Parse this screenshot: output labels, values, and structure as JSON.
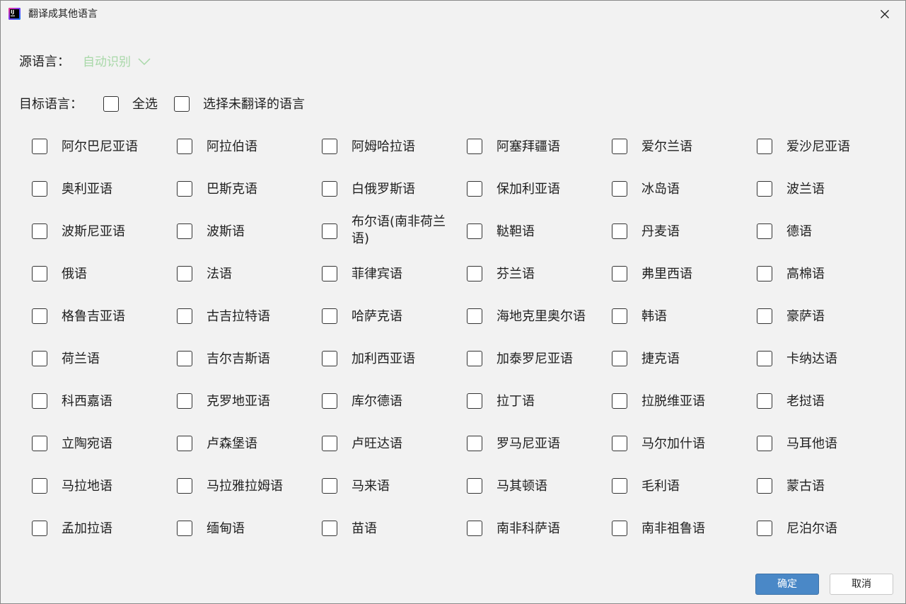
{
  "window": {
    "title": "翻译成其他语言"
  },
  "source": {
    "label": "源语言：",
    "value": "自动识别"
  },
  "target": {
    "label": "目标语言：",
    "select_all": "全选",
    "select_untranslated": "选择未翻译的语言"
  },
  "languages": [
    [
      "阿尔巴尼亚语",
      "阿拉伯语",
      "阿姆哈拉语",
      "阿塞拜疆语",
      "爱尔兰语",
      "爱沙尼亚语"
    ],
    [
      "奥利亚语",
      "巴斯克语",
      "白俄罗斯语",
      "保加利亚语",
      "冰岛语",
      "波兰语"
    ],
    [
      "波斯尼亚语",
      "波斯语",
      "布尔语(南非荷兰语)",
      "鞑靼语",
      "丹麦语",
      "德语"
    ],
    [
      "俄语",
      "法语",
      "菲律宾语",
      "芬兰语",
      "弗里西语",
      "高棉语"
    ],
    [
      "格鲁吉亚语",
      "古吉拉特语",
      "哈萨克语",
      "海地克里奥尔语",
      "韩语",
      "豪萨语"
    ],
    [
      "荷兰语",
      "吉尔吉斯语",
      "加利西亚语",
      "加泰罗尼亚语",
      "捷克语",
      "卡纳达语"
    ],
    [
      "科西嘉语",
      "克罗地亚语",
      "库尔德语",
      "拉丁语",
      "拉脱维亚语",
      "老挝语"
    ],
    [
      "立陶宛语",
      "卢森堡语",
      "卢旺达语",
      "罗马尼亚语",
      "马尔加什语",
      "马耳他语"
    ],
    [
      "马拉地语",
      "马拉雅拉姆语",
      "马来语",
      "马其顿语",
      "毛利语",
      "蒙古语"
    ],
    [
      "孟加拉语",
      "缅甸语",
      "苗语",
      "南非科萨语",
      "南非祖鲁语",
      "尼泊尔语"
    ]
  ],
  "buttons": {
    "ok": "确定",
    "cancel": "取消"
  }
}
